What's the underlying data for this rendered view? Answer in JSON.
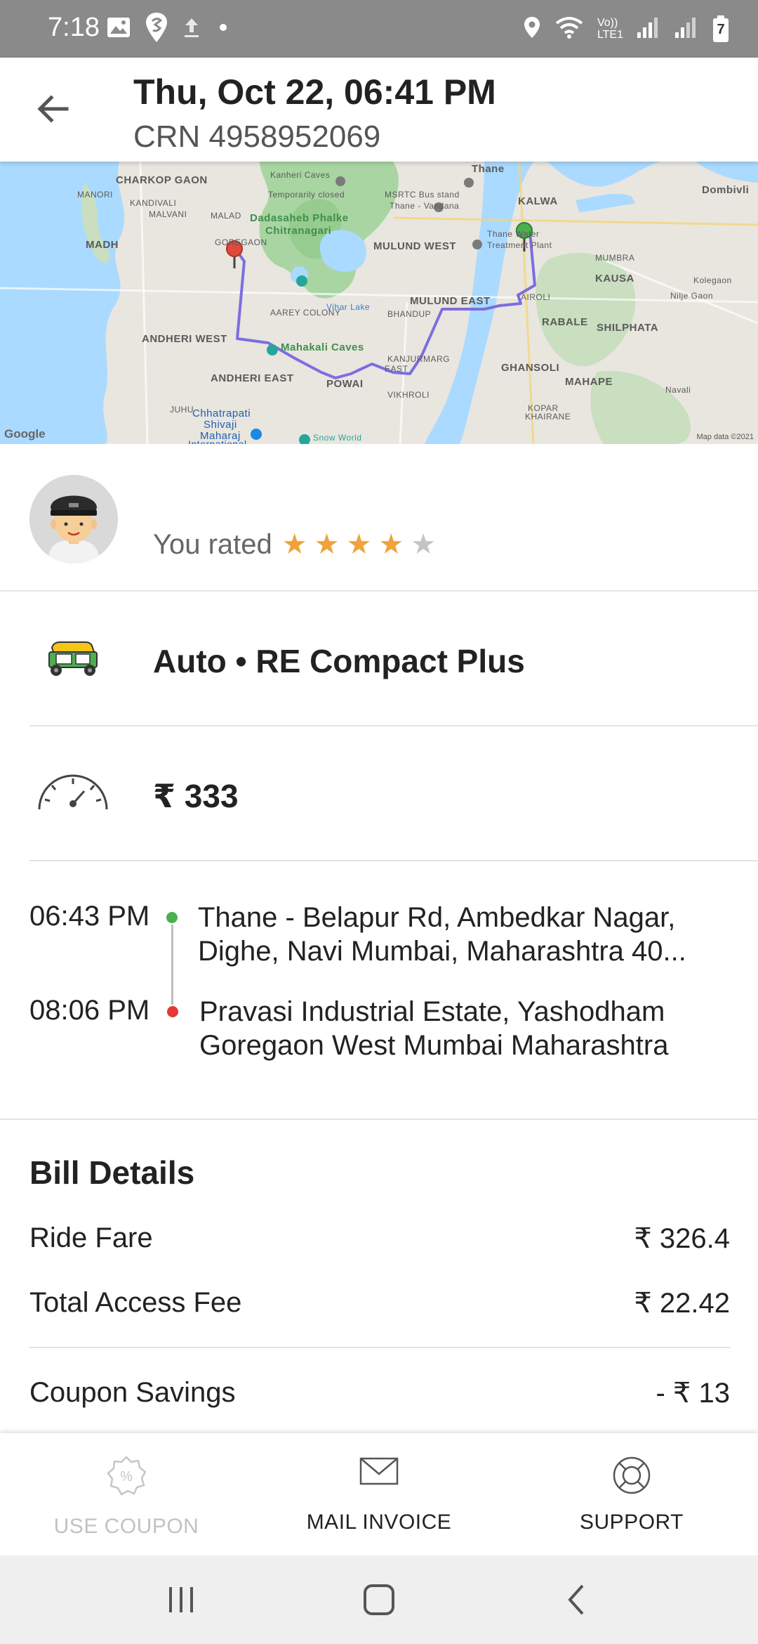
{
  "status_bar": {
    "time": "7:18",
    "volte": "Vo))",
    "lte": "LTE1",
    "battery": "7"
  },
  "header": {
    "title": "Thu, Oct 22, 06:41 PM",
    "crn": "CRN 4958952069"
  },
  "map": {
    "labels": {
      "charkop": "CHARKOP GAON",
      "kandivali": "KANDIVALI",
      "manori": "MANORI",
      "malvani": "MALVANI",
      "malad": "MALAD",
      "madh": "MADH",
      "goregaon": "GOREGAON",
      "kanheri": "Kanheri Caves",
      "kanheri_status": "Temporarily closed",
      "dadasaheb": "Dadasaheb Phalke",
      "chitranagari": "Chitranagari",
      "aarey": "AAREY COLONY",
      "msrtc": "MSRTC Bus stand",
      "msrtc2": "Thane - Vandana",
      "thane": "Thane",
      "kalwa": "KALWA",
      "dombivli": "Dombivli",
      "mulund_west": "MULUND WEST",
      "mulund_east": "MULUND EAST",
      "treatment": "Thane Water",
      "treatment2": "Treatment Plant",
      "mumbra": "MUMBRA",
      "kausa": "KAUSA",
      "kolegaon": "Kolegaon",
      "nilje": "Nilje Gaon",
      "airoli": "AIROLI",
      "rabale": "RABALE",
      "shilphata": "SHILPHATA",
      "vihar": "Vihar Lake",
      "bhandup": "BHANDUP",
      "andheri_west": "ANDHERI WEST",
      "mahakali": "Mahakali Caves",
      "andheri_east": "ANDHERI EAST",
      "powai": "POWAI",
      "kanjurmarg": "KANJURMARG",
      "kanjurmarg2": "EAST",
      "vikhroli": "VIKHROLI",
      "ghansoli": "GHANSOLI",
      "mahape": "MAHAPE",
      "navali": "Navali",
      "kopar": "KOPAR",
      "khairane": "KHAIRANE",
      "juhu": "JUHU",
      "chhatrapati": "Chhatrapati",
      "shivaji": "Shivaji",
      "maharaj": "Maharaj",
      "international": "International",
      "snow_world": "Snow World",
      "google": "Google",
      "map_data": "Map data ©2021"
    }
  },
  "driver": {
    "avatar_icon": "driver-avatar",
    "rated_label": "You rated",
    "rating": 4,
    "rating_max": 5,
    "star_color_on": "#f0a23b",
    "star_color_off": "#c4c4c4"
  },
  "vehicle": {
    "icon": "auto-rickshaw-icon",
    "label": "Auto • RE Compact Plus"
  },
  "fare": {
    "icon": "speedometer-icon",
    "amount": "₹ 333"
  },
  "trip": {
    "pickup_time": "06:43 PM",
    "pickup_address_line1": "Thane - Belapur Rd, Ambedkar Nagar,",
    "pickup_address_line2": "Dighe, Navi Mumbai, Maharashtra 40...",
    "drop_time": "08:06 PM",
    "drop_address_line1": "Pravasi Industrial Estate, Yashodham",
    "drop_address_line2": "Goregaon West Mumbai Maharashtra"
  },
  "bill": {
    "title": "Bill Details",
    "rows": [
      {
        "label": "Ride Fare",
        "value": "₹ 326.4"
      },
      {
        "label": "Total Access Fee",
        "value": "₹ 22.42"
      },
      {
        "label": "Coupon Savings",
        "value": "- ₹ 13"
      }
    ]
  },
  "actions": {
    "use_coupon": "USE COUPON",
    "mail_invoice": "MAIL INVOICE",
    "support": "SUPPORT"
  }
}
